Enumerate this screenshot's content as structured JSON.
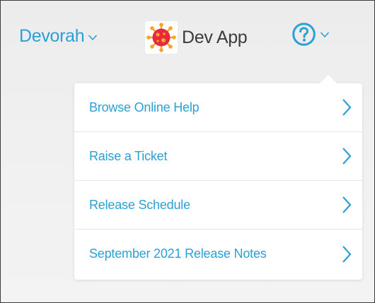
{
  "header": {
    "user_name": "Devorah",
    "app_name": "Dev App",
    "app_logo_icon": "virus-icon",
    "help_icon": "question-circle-icon"
  },
  "help_menu": {
    "items": [
      {
        "label": "Browse Online Help"
      },
      {
        "label": "Raise a Ticket"
      },
      {
        "label": "Release Schedule"
      },
      {
        "label": "September 2021 Release Notes"
      }
    ]
  },
  "colors": {
    "accent": "#2aa0d6",
    "text_dark": "#3b3b3b",
    "logo_red": "#e8283c",
    "logo_orange": "#f6a623"
  }
}
